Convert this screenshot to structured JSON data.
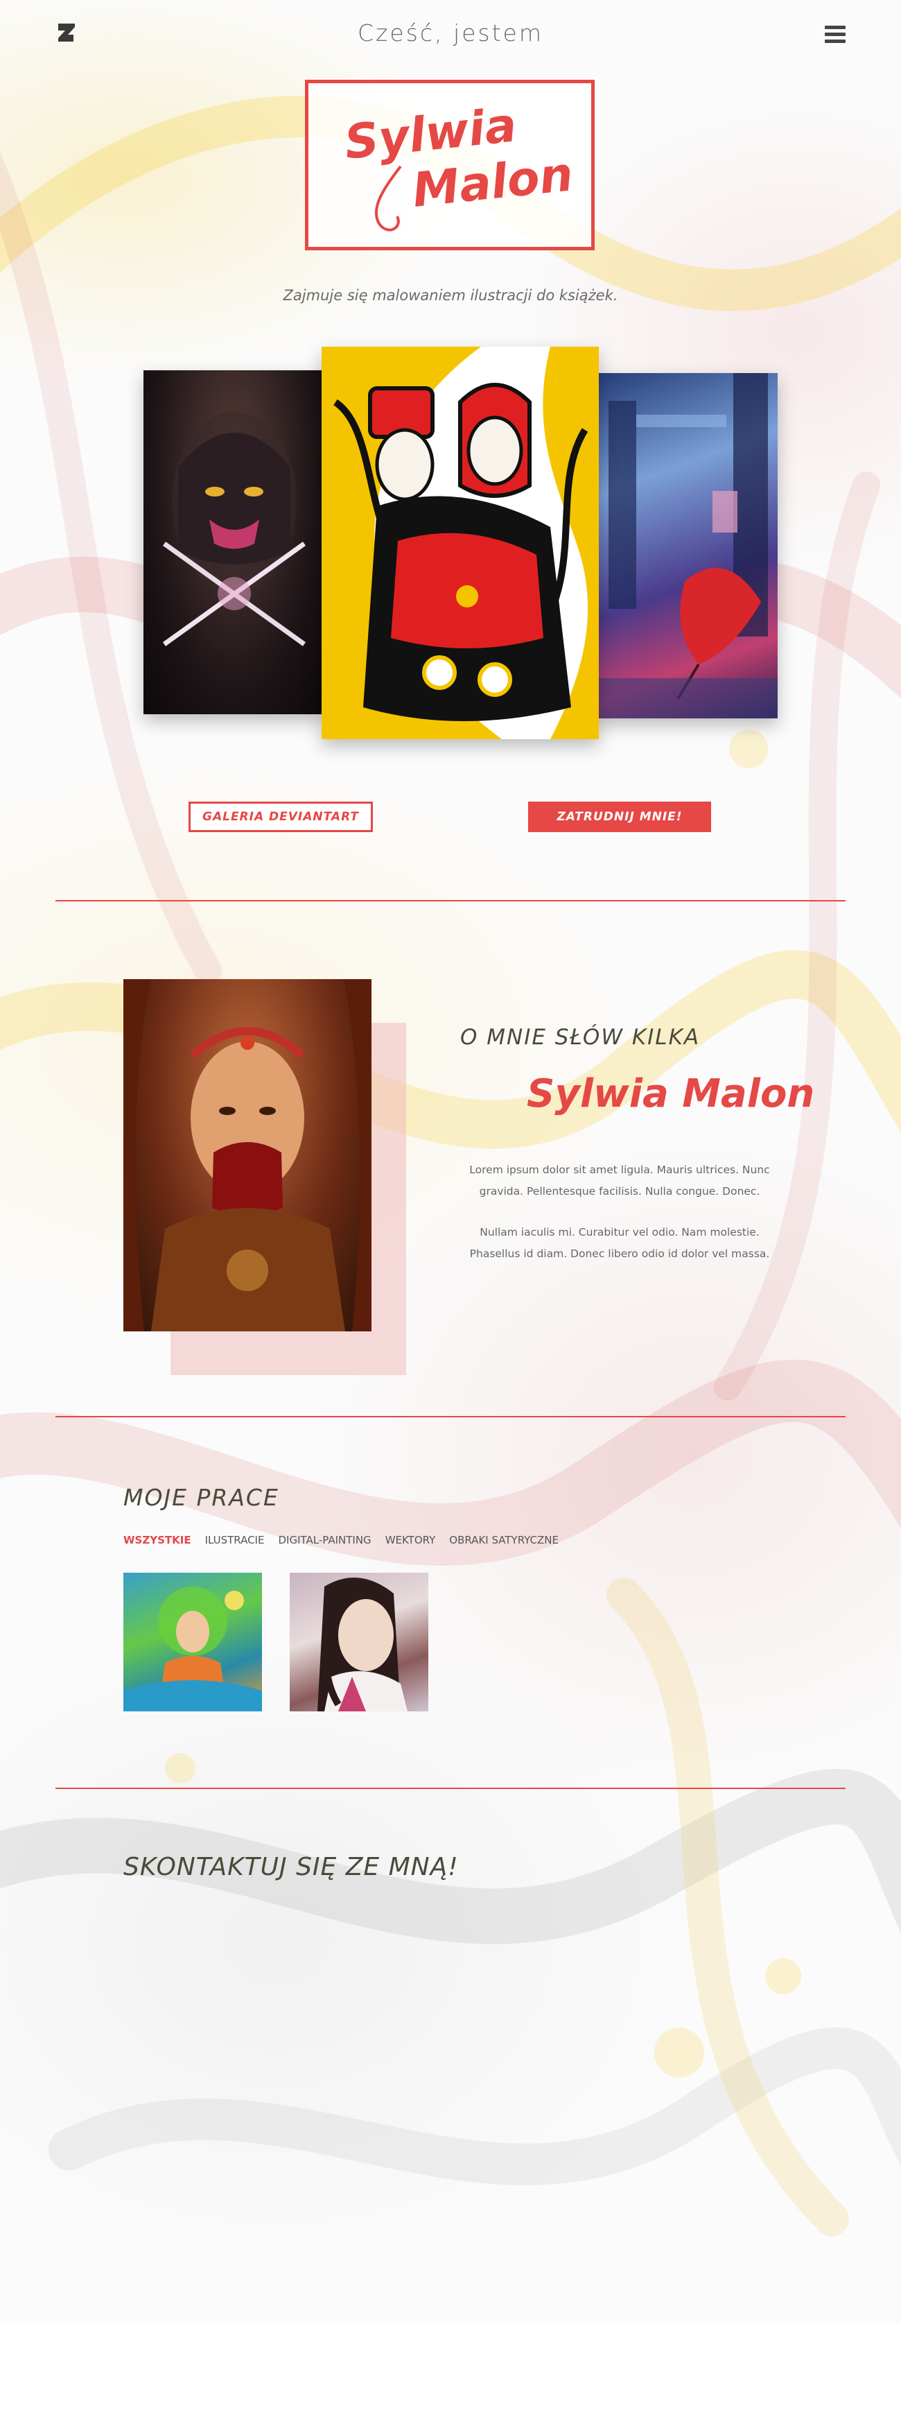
{
  "header": {
    "greeting": "Cześć, jestem",
    "brand_icon": "deviantart-icon",
    "menu_icon": "hamburger-menu-icon"
  },
  "logo": {
    "line1": "Sylwia",
    "line2": "Malon"
  },
  "tagline": "Zajmuje się malowaniem ilustracji do książek.",
  "hero_buttons": {
    "gallery": "GALERIA DEVIANTART",
    "hire": "ZATRUDNIJ MNIE!"
  },
  "about": {
    "heading": "O MNIE SŁÓW KILKA",
    "name": "Sylwia Malon",
    "paragraphs": [
      "Lorem ipsum dolor sit amet ligula. Mauris ultrices. Nunc gravida. Pellentesque facilisis. Nulla congue. Donec.",
      "Nullam iaculis mi. Curabitur vel odio. Nam molestie. Phasellus id diam. Donec libero odio id dolor vel massa."
    ]
  },
  "works": {
    "heading": "MOJE PRACE",
    "filters": [
      "WSZYSTKIE",
      "ILUSTRACIE",
      "DIGITAL-PAINTING",
      "WEKTORY",
      "OBRAKI SATYRYCZNE"
    ],
    "active_filter": "WSZYSTKIE"
  },
  "contact": {
    "heading": "SKONTAKTUJ SIĘ ZE MNĄ!"
  },
  "colors": {
    "accent": "#e54845",
    "heading": "#4a4a3a",
    "text": "#666666"
  }
}
